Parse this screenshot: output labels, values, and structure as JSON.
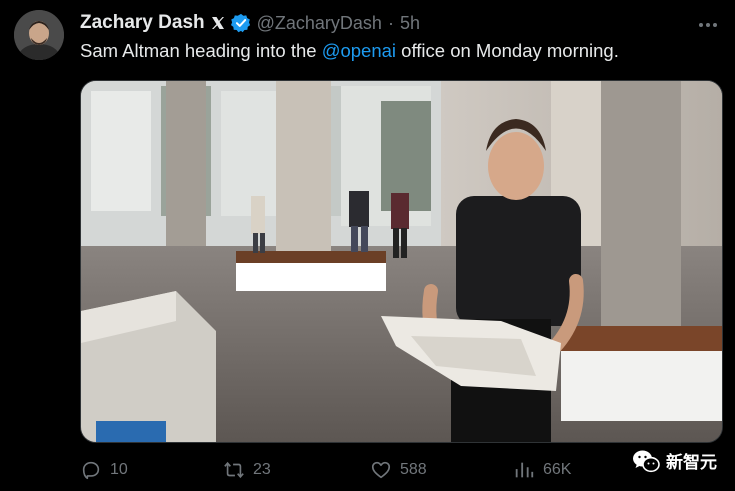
{
  "author": {
    "name": "Zachary Dash",
    "handle": "@ZacharyDash",
    "separator": "·",
    "time": "5h"
  },
  "tweet": {
    "text_before": "Sam Altman heading into the ",
    "mention": "@openai",
    "text_after": " office on Monday morning."
  },
  "actions": {
    "replies": "10",
    "retweets": "23",
    "likes": "588",
    "views": "66K"
  },
  "watermark": {
    "label": "新智元"
  },
  "colors": {
    "accent": "#1d9bf0",
    "muted": "#71767b",
    "background": "#000000"
  },
  "icons": [
    "x-premium-icon",
    "verified-badge-icon",
    "more-icon",
    "reply-icon",
    "retweet-icon",
    "like-icon",
    "views-icon",
    "wechat-icon"
  ]
}
